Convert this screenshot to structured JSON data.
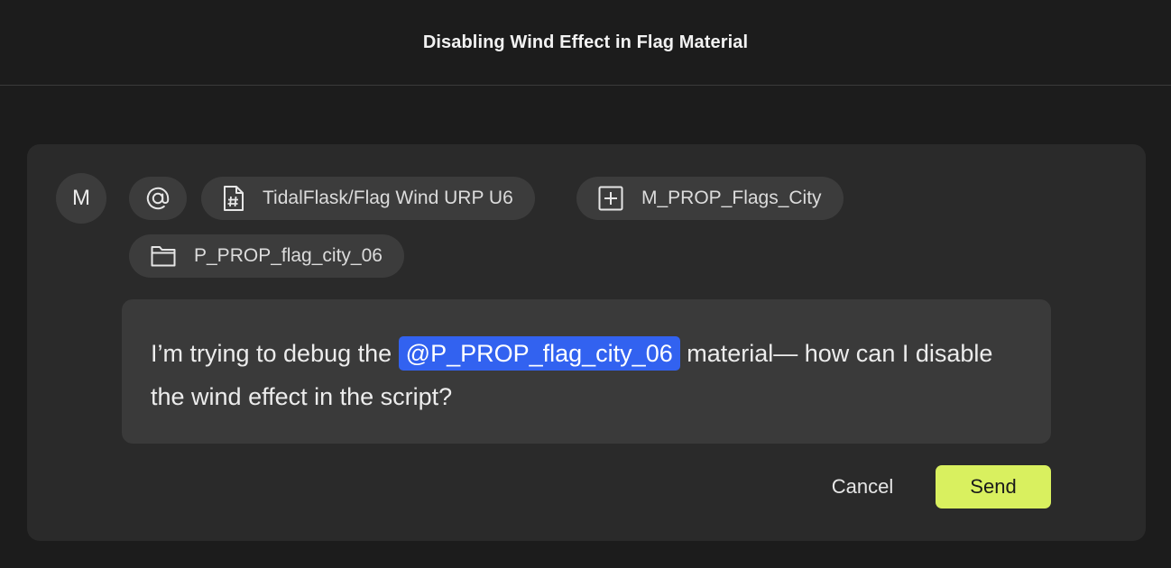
{
  "header": {
    "title": "Disabling Wind Effect in Flag Material"
  },
  "composer": {
    "avatar_initial": "M",
    "chips": {
      "mention_icon": "at-icon",
      "script": {
        "icon": "script-hash-icon",
        "label": "TidalFlask/Flag Wind URP U6"
      },
      "material": {
        "icon": "plus-square-icon",
        "label": "M_PROP_Flags_City"
      },
      "prefab": {
        "icon": "folder-icon",
        "label": "P_PROP_flag_city_06"
      }
    },
    "message": {
      "text_before": "I’m trying to debug the ",
      "mention": "@P_PROP_flag_city_06",
      "text_after": " material— how can I disable the wind effect in the script?"
    },
    "cancel_label": "Cancel",
    "send_label": "Send"
  },
  "colors": {
    "background": "#1c1c1c",
    "panel": "#2a2a2a",
    "chip": "#3c3c3c",
    "mention": "#3262f0",
    "send": "#d9f05f"
  }
}
